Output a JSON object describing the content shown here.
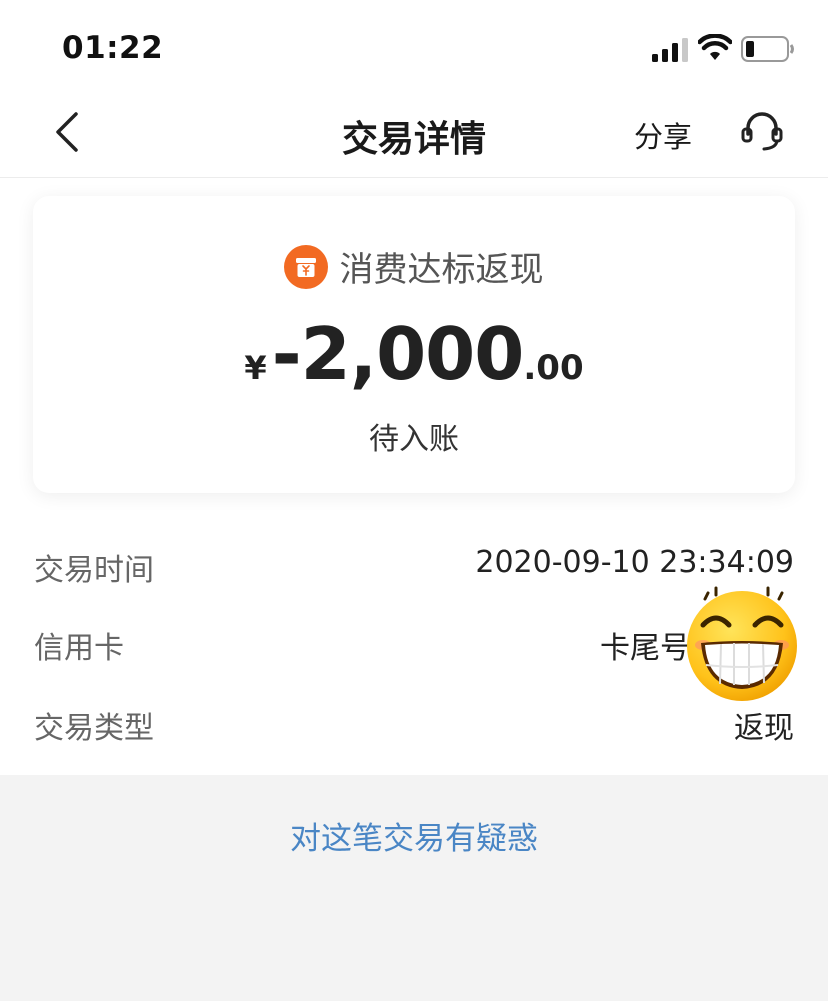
{
  "status_bar": {
    "time": "01:22",
    "icons": [
      "signal-icon",
      "wifi-icon",
      "battery-icon"
    ]
  },
  "nav": {
    "title": "交易详情",
    "share_label": "分享",
    "icons": [
      "back-icon",
      "customer-service-icon"
    ]
  },
  "card": {
    "tag_icon": "yuan-bag-icon",
    "tag_label": "消费达标返现",
    "currency": "¥",
    "amount_integer": "-2,000",
    "amount_decimal": ".00",
    "status": "待入账"
  },
  "details": [
    {
      "label": "交易时间",
      "value": "2020-09-10 23:34:09"
    },
    {
      "label": "信用卡",
      "value": "卡尾号"
    },
    {
      "label": "交易类型",
      "value": "返现"
    }
  ],
  "doubt_link": "对这笔交易有疑惑",
  "colors": {
    "accent_orange": "#f26a22",
    "link_blue": "#4a86c5",
    "bottom_bg": "#f3f3f3"
  }
}
